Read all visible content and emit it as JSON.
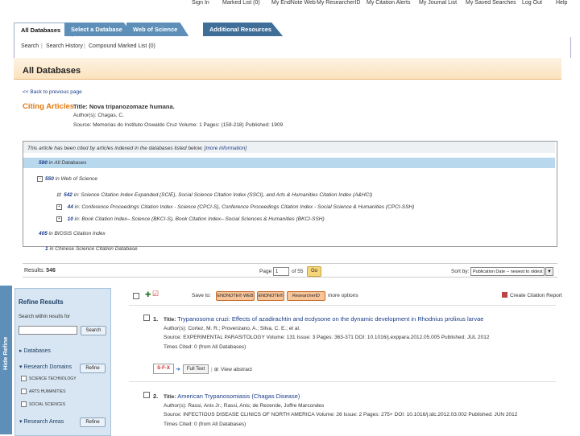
{
  "top_links": [
    "Sign In",
    "Marked List (0)",
    "My EndNote Web",
    "My ResearcherID",
    "My Citation Alerts",
    "My Journal List",
    "My Saved Searches",
    "Log Out",
    "Help"
  ],
  "tabs": [
    "All Databases",
    "Select a Database",
    "Web of Science",
    "Additional Resources"
  ],
  "subnav": [
    "Search",
    "Search History",
    "Compound Marked List (0)"
  ],
  "page_title": "All Databases",
  "back_link": "<< Back to previous page",
  "citing": {
    "label": "Citing Articles",
    "title_label": "Title:",
    "title": "Nova tripanozomaze humana.",
    "authors": "Author(s): Chagas, C.",
    "source": "Source: Memorias do Instituto Oswaldo Cruz   Volume: 1   Pages: (159-218)   Published: 1909"
  },
  "indexed": {
    "intro": "This article has been cited by articles indexed in the databases listed below. [",
    "more_info": "more information",
    "intro_end": "]",
    "rows": [
      {
        "count": "580",
        "text": "in All Databases"
      },
      {
        "count": "550",
        "text": "in Web of Science"
      },
      {
        "count": "542",
        "text": "in: Science Citation Index Expanded (SCIE), Social Science Citation Index (SSCI), and Arts & Humanities Citation Index (A&HCI)"
      },
      {
        "count": "44",
        "text": "in: Conference Proceedings Citation Index - Science (CPCI-S), Conference Proceedings Citation Index - Social Science & Humanities (CPCI-SSH)"
      },
      {
        "count": "10",
        "text": "in: Book Citation Index– Science (BKCI-S), Book Citation Index– Social Sciences & Humanities (BKCI-SSH)"
      },
      {
        "count": "405",
        "text": "in BIOSIS Citation Index"
      },
      {
        "count": "1",
        "text": "in Chinese Science Citation Database"
      }
    ]
  },
  "results_bar": {
    "label": "Results:",
    "count": "546",
    "page_label": "Page",
    "page_value": "1",
    "of": "of 55",
    "go": "Go",
    "sort_label": "Sort by:",
    "sort_value": "Publication Date -- newest to oldest"
  },
  "hide_refine": "Hide Refine",
  "refine": {
    "title": "Refine Results",
    "search_within": "Search within results for",
    "search_btn": "Search",
    "databases": "Databases",
    "research_domains": "Research Domains",
    "refine_btn": "Refine",
    "domains": [
      "SCIENCE TECHNOLOGY",
      "ARTS HUMANITIES",
      "SOCIAL SCIENCES"
    ],
    "research_areas": "Research Areas"
  },
  "toolbar": {
    "save_to": "Save to:",
    "endnote_web": "ENDNOTE® WEB",
    "endnote": "ENDNOTE®",
    "researcherid": "ResearcherID",
    "more_options": "more options",
    "create_report": "Create Citation Report"
  },
  "records": [
    {
      "num": "1.",
      "title_label": "Title:",
      "title": "Trypanosoma cruzi: Effects of azadirachtin and ecdysone on the dynamic development in Rhodnius prolixus larvae",
      "authors": "Author(s): Cortez, M. R.; Provenzano, A.; Silva, C. E.; et al.",
      "source": "Source: EXPERIMENTAL PARASITOLOGY   Volume: 131   Issue: 3   Pages: 363-371   DOI: 10.1016/j.exppara.2012.05.005   Published: JUL 2012",
      "cited": "Times Cited: 0 (from All Databases)",
      "sfx": "S·F·X",
      "full_text": "Full Text",
      "view_abstract": "View abstract"
    },
    {
      "num": "2.",
      "title_label": "Title:",
      "title": "American Trypanosomiasis (Chagas Disease)",
      "authors": "Author(s): Rassi, Anis Jr.; Rassi, Anis; de Rezende, Joffre Marcondes",
      "source": "Source: INFECTIOUS DISEASE CLINICS OF NORTH AMERICA   Volume: 26   Issue: 2   Pages: 275+   DOI: 10.1016/j.idc.2012.03.002   Published: JUN 2012",
      "cited": "Times Cited: 0 (from All Databases)"
    }
  ]
}
